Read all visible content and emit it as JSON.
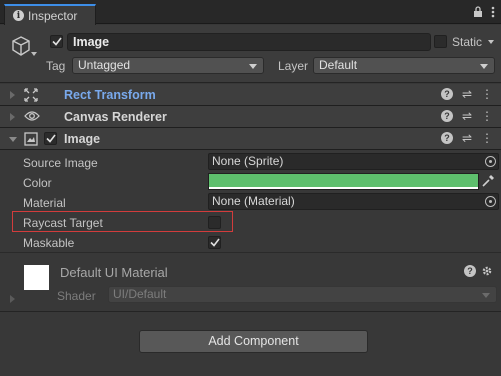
{
  "tab": {
    "title": "Inspector"
  },
  "gameobject": {
    "name": "Image",
    "static_label": "Static",
    "tag_label": "Tag",
    "tag_value": "Untagged",
    "layer_label": "Layer",
    "layer_value": "Default"
  },
  "components": [
    {
      "name": "Rect Transform",
      "expanded": false
    },
    {
      "name": "Canvas Renderer",
      "expanded": false
    },
    {
      "name": "Image",
      "expanded": true
    }
  ],
  "image": {
    "source_image_label": "Source Image",
    "source_image_value": "None (Sprite)",
    "color_label": "Color",
    "color_value": "#5ebf6d",
    "material_label": "Material",
    "material_value": "None (Material)",
    "raycast_label": "Raycast Target",
    "raycast_checked": false,
    "maskable_label": "Maskable",
    "maskable_checked": true
  },
  "material": {
    "title": "Default UI Material",
    "shader_label": "Shader",
    "shader_value": "UI/Default"
  },
  "add_component_label": "Add Component",
  "icons": [
    "info-icon",
    "lock-icon",
    "menu-icon",
    "cube-icon",
    "rect-transform-icon",
    "eye-icon",
    "image-icon",
    "help-icon",
    "sliders-icon",
    "more-icon",
    "picker-icon",
    "eyedropper-icon",
    "gear-icon"
  ],
  "colors": {
    "tab_accent": "#3d8ee8",
    "highlight_border": "#d23c3c",
    "link_blue": "#79a9ec"
  }
}
